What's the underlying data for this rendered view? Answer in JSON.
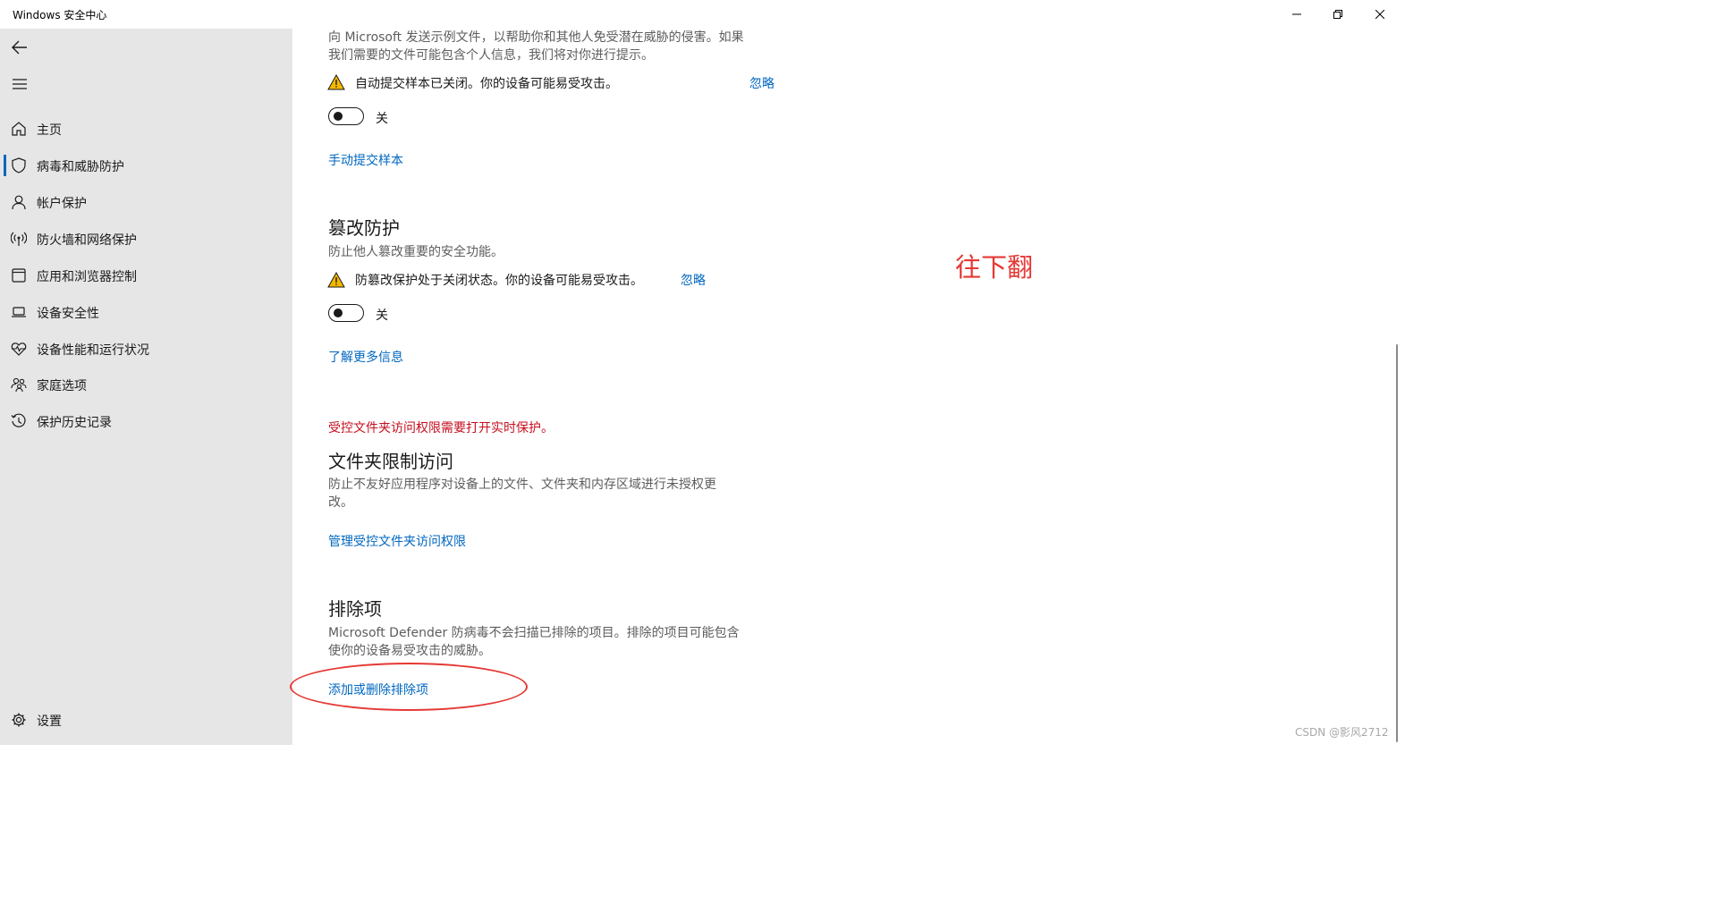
{
  "window": {
    "title": "Windows 安全中心",
    "minimize_icon": "minimize-icon",
    "restore_icon": "restore-icon",
    "close_icon": "close-icon"
  },
  "sidebar": {
    "back_icon": "back-arrow-icon",
    "menu_icon": "hamburger-menu-icon",
    "items": [
      {
        "label": "主页",
        "icon": "home-icon"
      },
      {
        "label": "病毒和威胁防护",
        "icon": "shield-icon",
        "active": true
      },
      {
        "label": "帐户保护",
        "icon": "person-icon"
      },
      {
        "label": "防火墙和网络保护",
        "icon": "wireless-signal-icon"
      },
      {
        "label": "应用和浏览器控制",
        "icon": "app-window-icon"
      },
      {
        "label": "设备安全性",
        "icon": "laptop-icon"
      },
      {
        "label": "设备性能和运行状况",
        "icon": "heart-pulse-icon"
      },
      {
        "label": "家庭选项",
        "icon": "family-icon"
      },
      {
        "label": "保护历史记录",
        "icon": "history-icon"
      }
    ],
    "settings": {
      "label": "设置",
      "icon": "gear-icon"
    }
  },
  "sample_submission": {
    "description_line1": "向 Microsoft 发送示例文件，以帮助你和其他人免受潜在威胁的侵害。如果",
    "description_line2": "我们需要的文件可能包含个人信息，我们将对你进行提示。",
    "warning": "自动提交样本已关闭。你的设备可能易受攻击。",
    "dismiss": "忽略",
    "toggle_state": "关",
    "link": "手动提交样本"
  },
  "tamper_protection": {
    "title": "篡改防护",
    "description": "防止他人篡改重要的安全功能。",
    "warning": "防篡改保护处于关闭状态。你的设备可能易受攻击。",
    "dismiss": "忽略",
    "toggle_state": "关",
    "link": "了解更多信息"
  },
  "controlled_folder": {
    "error": "受控文件夹访问权限需要打开实时保护。",
    "title": "文件夹限制访问",
    "description_line1": "防止不友好应用程序对设备上的文件、文件夹和内存区域进行未授权更",
    "description_line2": "改。",
    "link": "管理受控文件夹访问权限"
  },
  "exclusions": {
    "title": "排除项",
    "description_line1": "Microsoft Defender 防病毒不会扫描已排除的项目。排除的项目可能包含",
    "description_line2": "使你的设备易受攻击的威胁。",
    "link": "添加或删除排除项"
  },
  "annotation": {
    "text": "往下翻",
    "color": "#e53935"
  },
  "watermark": "CSDN @影风2712",
  "colors": {
    "accent": "#0067c0",
    "error": "#c50f1f",
    "warning_icon": "#f5b800",
    "sidebar_bg": "#e6e6e6"
  }
}
